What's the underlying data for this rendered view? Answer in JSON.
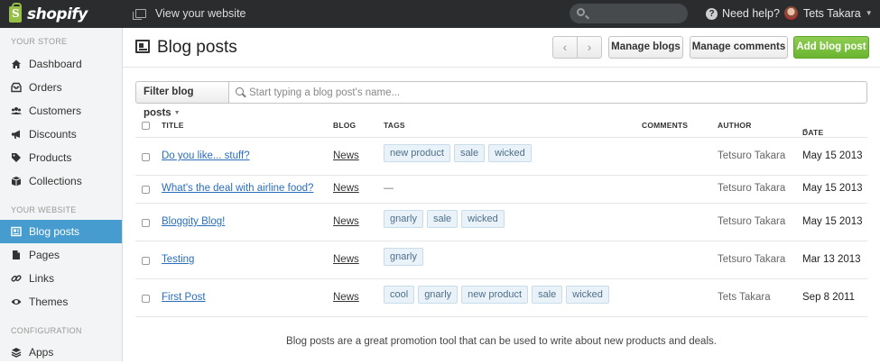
{
  "topbar": {
    "logo_text": "shopify",
    "view_site": "View your website",
    "help": "Need help?",
    "user_name": "Tets Takara"
  },
  "sidebar": {
    "sections": [
      {
        "heading": "YOUR STORE",
        "items": [
          {
            "label": "Dashboard",
            "icon": "home-icon"
          },
          {
            "label": "Orders",
            "icon": "inbox-icon"
          },
          {
            "label": "Customers",
            "icon": "users-icon"
          },
          {
            "label": "Discounts",
            "icon": "megaphone-icon"
          },
          {
            "label": "Products",
            "icon": "tag-icon"
          },
          {
            "label": "Collections",
            "icon": "box-icon"
          }
        ]
      },
      {
        "heading": "YOUR WEBSITE",
        "items": [
          {
            "label": "Blog posts",
            "icon": "newspaper-icon",
            "active": true
          },
          {
            "label": "Pages",
            "icon": "pages-icon"
          },
          {
            "label": "Links",
            "icon": "link-icon"
          },
          {
            "label": "Themes",
            "icon": "eye-icon"
          }
        ]
      },
      {
        "heading": "CONFIGURATION",
        "items": [
          {
            "label": "Apps",
            "icon": "apps-icon"
          }
        ]
      }
    ]
  },
  "header": {
    "title": "Blog posts",
    "prev": "‹",
    "next": "›",
    "manage_blogs": "Manage blogs",
    "manage_comments": "Manage comments",
    "add_post": "Add blog post"
  },
  "filter": {
    "button_label": "Filter blog posts",
    "placeholder": "Start typing a blog post's name..."
  },
  "table": {
    "columns": {
      "title": "TITLE",
      "blog": "BLOG",
      "tags": "TAGS",
      "comments": "COMMENTS",
      "author": "AUTHOR",
      "date": "DATE"
    },
    "rows": [
      {
        "title": "Do you like... stuff?",
        "blog": "News",
        "tags": [
          "new product",
          "sale",
          "wicked"
        ],
        "author": "Tetsuro Takara",
        "date": "May 15 2013"
      },
      {
        "title": "What's the deal with airline food?",
        "blog": "News",
        "tags": [],
        "empty_tags": "—",
        "author": "Tetsuro Takara",
        "date": "May 15 2013"
      },
      {
        "title": "Bloggity Blog!",
        "blog": "News",
        "tags": [
          "gnarly",
          "sale",
          "wicked"
        ],
        "author": "Tetsuro Takara",
        "date": "May 15 2013"
      },
      {
        "title": "Testing",
        "blog": "News",
        "tags": [
          "gnarly"
        ],
        "author": "Tetsuro Takara",
        "date": "Mar 13 2013"
      },
      {
        "title": "First Post",
        "blog": "News",
        "tags": [
          "cool",
          "gnarly",
          "new product",
          "sale",
          "wicked"
        ],
        "author": "Tets Takara",
        "date": "Sep 8 2011"
      }
    ]
  },
  "footer_note": "Blog posts are a great promotion tool that can be used to write about new products and deals.",
  "colors": {
    "topbar": "#2a2c2e",
    "active_nav": "#479ccf",
    "primary_button": "#7ac142",
    "link": "#2a6ebb",
    "tag_bg": "#eaf2f9"
  }
}
